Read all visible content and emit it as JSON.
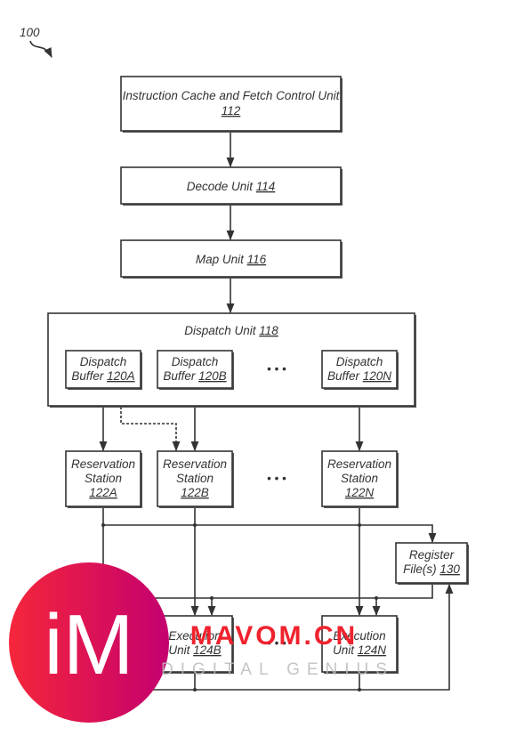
{
  "figure_label": "100",
  "blocks": {
    "fetch": {
      "name": "Instruction Cache and Fetch Control Unit",
      "ref": "112"
    },
    "decode": {
      "name": "Decode Unit",
      "ref": "114"
    },
    "map": {
      "name": "Map Unit",
      "ref": "116"
    },
    "dispatch": {
      "name": "Dispatch Unit",
      "ref": "118"
    },
    "buffers": [
      {
        "l1": "Dispatch",
        "l2": "Buffer",
        "ref": "120A"
      },
      {
        "l1": "Dispatch",
        "l2": "Buffer",
        "ref": "120B"
      },
      {
        "l1": "Dispatch",
        "l2": "Buffer",
        "ref": "120N"
      }
    ],
    "stations": [
      {
        "l1": "Reservation",
        "l2": "Station",
        "ref": "122A"
      },
      {
        "l1": "Reservation",
        "l2": "Station",
        "ref": "122B"
      },
      {
        "l1": "Reservation",
        "l2": "Station",
        "ref": "122N"
      }
    ],
    "exec": [
      {
        "l1": "Execution",
        "l2": "Unit",
        "ref": "124B"
      },
      {
        "l1": "Execution",
        "l2": "Unit",
        "ref": "124N"
      }
    ],
    "regfile": {
      "l1": "Register",
      "l2": "File(s)",
      "ref": "130"
    }
  },
  "ellipsis": "• • •",
  "watermark": {
    "logo": "iM",
    "text": "MAVOM.CN",
    "subtext": "DIGITAL GENIUS",
    "colors": [
      "#f5263a",
      "#c4006f"
    ]
  }
}
